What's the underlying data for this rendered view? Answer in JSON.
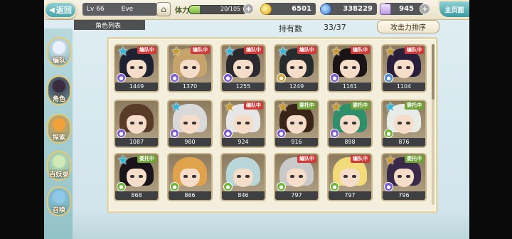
{
  "header": {
    "back_label": "返回",
    "player_level": "Lv 66",
    "player_name": "Eve",
    "home_icon": "home-icon",
    "stamina_label": "体力",
    "stamina_value": "20/105",
    "stamina_fraction": 0.19,
    "coins": "6501",
    "gems": "338229",
    "tickets": "945",
    "menu_label": "主页面"
  },
  "subheader": {
    "section_title": "角色列表",
    "owned_label": "持有数",
    "owned_count": "33/37",
    "sort_label": "攻击力排序"
  },
  "nav": [
    {
      "label": "编队",
      "icon": "team-icon",
      "color": "#e9f1ff"
    },
    {
      "label": "角色",
      "icon": "character-icon",
      "color": "#3a2b3e"
    },
    {
      "label": "探索",
      "icon": "explore-icon",
      "color": "#f2a13a"
    },
    {
      "label": "百妖录",
      "icon": "book-icon",
      "color": "#cfe9b7"
    },
    {
      "label": "召唤",
      "icon": "summon-icon",
      "color": "#8fc7e6"
    }
  ],
  "colors": {
    "team_badge": "#d23a3a",
    "entrust_badge": "#6fa236",
    "star_cyan": "#35b6d8",
    "star_gold": "#c79a2f"
  },
  "characters": [
    {
      "power": "1449",
      "badge": "编队中",
      "badge_type": "team",
      "star": "cyan",
      "elem": "#7a5bd0",
      "hair": "#1e2230"
    },
    {
      "power": "1370",
      "badge": "编队中",
      "badge_type": "team",
      "star": "gold",
      "elem": "#7a5bd0",
      "hair": "#c4a46a"
    },
    {
      "power": "1255",
      "badge": "编队中",
      "badge_type": "team",
      "star": "cyan",
      "elem": "#7a5bd0",
      "hair": "#2a2a2e"
    },
    {
      "power": "1249",
      "badge": "编队中",
      "badge_type": "team",
      "star": "cyan",
      "elem": "#d0a43a",
      "hair": "#262b2b"
    },
    {
      "power": "1161",
      "badge": "编队中",
      "badge_type": "team",
      "star": "gold",
      "elem": "#7a5bd0",
      "hair": "#1a1416"
    },
    {
      "power": "1104",
      "badge": "编队中",
      "badge_type": "team",
      "star": "gold",
      "elem": "#4a8bd6",
      "hair": "#2a1f3a"
    },
    {
      "power": "1087",
      "badge": "",
      "badge_type": "",
      "star": "",
      "elem": "#7a5bd0",
      "hair": "#5a3b2a"
    },
    {
      "power": "980",
      "badge": "",
      "badge_type": "",
      "star": "cyan",
      "elem": "#7a5bd0",
      "hair": "#d9d9d9"
    },
    {
      "power": "924",
      "badge": "编队中",
      "badge_type": "team",
      "star": "gold",
      "elem": "#7a5bd0",
      "hair": "#e6e6e6"
    },
    {
      "power": "916",
      "badge": "委托中",
      "badge_type": "entrust",
      "star": "gold",
      "elem": "#7a5bd0",
      "hair": "#3a2418"
    },
    {
      "power": "898",
      "badge": "委托中",
      "badge_type": "entrust",
      "star": "gold",
      "elem": "#7a5bd0",
      "hair": "#2f8f6a"
    },
    {
      "power": "876",
      "badge": "委托中",
      "badge_type": "entrust",
      "star": "cyan",
      "elem": "#6fb43a",
      "hair": "#e8ece6"
    },
    {
      "power": "868",
      "badge": "委托中",
      "badge_type": "entrust",
      "star": "cyan",
      "elem": "#6fb43a",
      "hair": "#18141a"
    },
    {
      "power": "866",
      "badge": "",
      "badge_type": "",
      "star": "",
      "elem": "#6fb43a",
      "hair": "#e0a24a"
    },
    {
      "power": "846",
      "badge": "",
      "badge_type": "",
      "star": "",
      "elem": "#6fb43a",
      "hair": "#b9d7d9"
    },
    {
      "power": "797",
      "badge": "编队中",
      "badge_type": "team",
      "star": "",
      "elem": "#6fb43a",
      "hair": "#c9c9c9"
    },
    {
      "power": "797",
      "badge": "编队中",
      "badge_type": "team",
      "star": "",
      "elem": "#6fb43a",
      "hair": "#f2dc7a"
    },
    {
      "power": "796",
      "badge": "委托中",
      "badge_type": "entrust",
      "star": "gold",
      "elem": "#7a5bd0",
      "hair": "#3a2a4a"
    }
  ]
}
